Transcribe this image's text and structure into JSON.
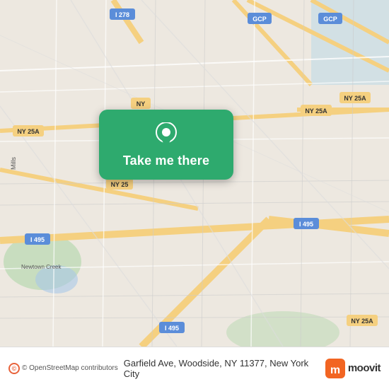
{
  "map": {
    "background_color": "#e8e0d8"
  },
  "button": {
    "label": "Take me there"
  },
  "bottom_bar": {
    "osm_label": "© OpenStreetMap contributors",
    "address": "Garfield Ave, Woodside, NY 11377, New York City",
    "moovit_label": "moovit"
  }
}
